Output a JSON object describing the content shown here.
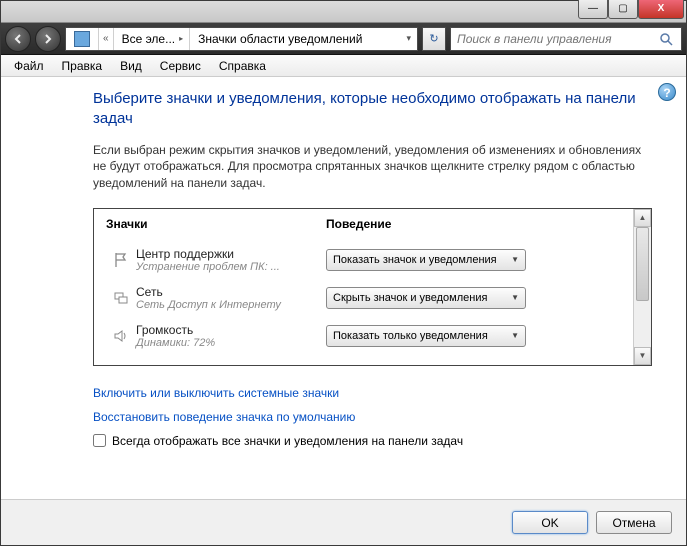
{
  "window_controls": {
    "minimize": "—",
    "maximize": "▢",
    "close": "X"
  },
  "nav": {
    "breadcrumb": [
      "Все эле...",
      "Значки области уведомлений"
    ],
    "dropdown_glyph": "▾",
    "refresh_glyph": "↻",
    "search_placeholder": "Поиск в панели управления"
  },
  "menu": [
    "Файл",
    "Правка",
    "Вид",
    "Сервис",
    "Справка"
  ],
  "heading": "Выберите значки и уведомления, которые необходимо отображать на панели задач",
  "description": "Если выбран режим скрытия значков и уведомлений, уведомления об изменениях и обновлениях не будут отображаться. Для просмотра спрятанных значков щелкните стрелку рядом с областью уведомлений на панели задач.",
  "table": {
    "col_icons": "Значки",
    "col_behavior": "Поведение",
    "rows": [
      {
        "title": "Центр поддержки",
        "sub": "Устранение проблем ПК: ...",
        "value": "Показать значок и уведомления"
      },
      {
        "title": "Сеть",
        "sub": "Сеть Доступ к Интернету",
        "value": "Скрыть значок и уведомления"
      },
      {
        "title": "Громкость",
        "sub": "Динамики: 72%",
        "value": "Показать только уведомления"
      }
    ]
  },
  "link_system_icons": "Включить или выключить системные значки",
  "link_restore": "Восстановить поведение значка по умолчанию",
  "checkbox_label": "Всегда отображать все значки и уведомления на панели задач",
  "buttons": {
    "ok": "OK",
    "cancel": "Отмена"
  }
}
